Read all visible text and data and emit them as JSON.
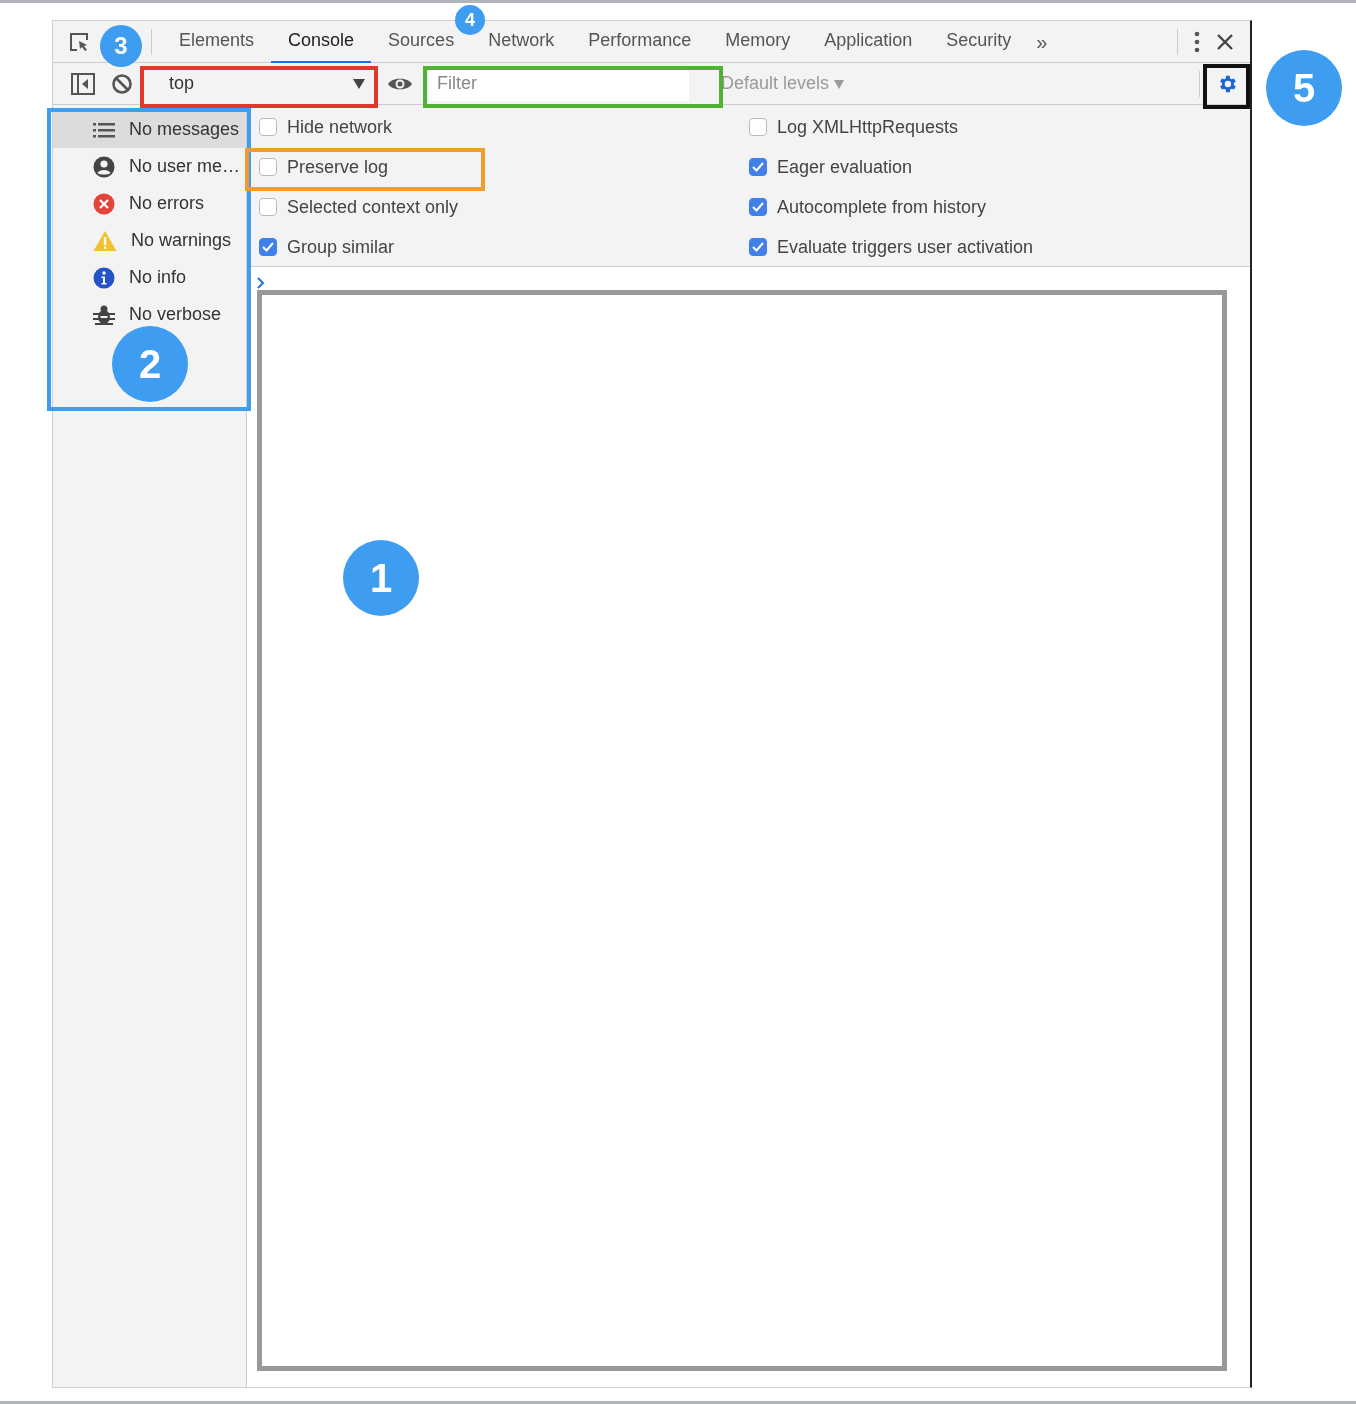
{
  "toolbar": {
    "tabs": [
      {
        "label": "Elements",
        "selected": false
      },
      {
        "label": "Console",
        "selected": true
      },
      {
        "label": "Sources",
        "selected": false
      },
      {
        "label": "Network",
        "selected": false
      },
      {
        "label": "Performance",
        "selected": false
      },
      {
        "label": "Memory",
        "selected": false
      },
      {
        "label": "Application",
        "selected": false
      },
      {
        "label": "Security",
        "selected": false
      }
    ],
    "overflow": "»"
  },
  "console_toolbar": {
    "context": "top",
    "filter": {
      "placeholder": "Filter"
    },
    "levels": "Default levels"
  },
  "sidebar": {
    "items": [
      {
        "kind": "list",
        "label": "No messages",
        "selected": true
      },
      {
        "kind": "user",
        "label": "No user me…",
        "selected": false
      },
      {
        "kind": "error",
        "label": "No errors",
        "selected": false
      },
      {
        "kind": "warning",
        "label": "No warnings",
        "selected": false
      },
      {
        "kind": "info",
        "label": "No info",
        "selected": false
      },
      {
        "kind": "verbose",
        "label": "No verbose",
        "selected": false
      }
    ]
  },
  "settings": {
    "columns": [
      [
        {
          "label": "Hide network",
          "checked": false
        },
        {
          "label": "Preserve log",
          "checked": false
        },
        {
          "label": "Selected context only",
          "checked": false
        },
        {
          "label": "Group similar",
          "checked": true
        }
      ],
      [
        {
          "label": "Log XMLHttpRequests",
          "checked": false
        },
        {
          "label": "Eager evaluation",
          "checked": true
        },
        {
          "label": "Autocomplete from history",
          "checked": true
        },
        {
          "label": "Evaluate triggers user activation",
          "checked": true
        }
      ]
    ]
  },
  "annotations": {
    "badges": [
      {
        "label": "3"
      },
      {
        "label": "4"
      },
      {
        "label": "5"
      },
      {
        "label": "2"
      },
      {
        "label": "1"
      }
    ],
    "highlights": [
      {
        "color": "#e0392b"
      },
      {
        "color": "#4fb233"
      },
      {
        "color": "#111111"
      },
      {
        "color": "#3d9ef0"
      },
      {
        "color": "#f39a2e"
      },
      {
        "color": "#999999"
      }
    ]
  }
}
